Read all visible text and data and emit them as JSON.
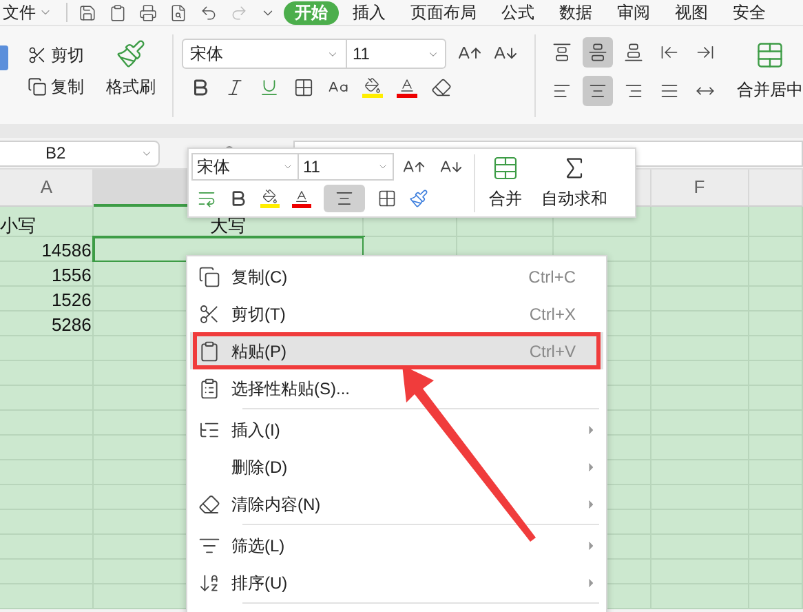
{
  "menu_bar": {
    "file": "文件",
    "tabs": [
      {
        "label": "开始",
        "selected": true
      },
      {
        "label": "插入",
        "selected": false
      },
      {
        "label": "页面布局",
        "selected": false
      },
      {
        "label": "公式",
        "selected": false
      },
      {
        "label": "数据",
        "selected": false
      },
      {
        "label": "审阅",
        "selected": false
      },
      {
        "label": "视图",
        "selected": false
      },
      {
        "label": "安全",
        "selected": false
      }
    ]
  },
  "ribbon": {
    "cut": "剪切",
    "copy": "复制",
    "format_painter": "格式刷",
    "font": "宋体",
    "size": "11",
    "align_top": [
      {
        "selected": false
      },
      {
        "selected": true
      },
      {
        "selected": false
      },
      {
        "selected": false
      },
      {
        "selected": false
      }
    ],
    "align_bottom": [
      {
        "selected": false
      },
      {
        "selected": true
      },
      {
        "selected": false
      },
      {
        "selected": false
      },
      {
        "selected": false
      }
    ],
    "merge": "合并居中"
  },
  "formula_bar": {
    "name_box": "B2"
  },
  "sheet": {
    "columns": [
      {
        "label": "A"
      },
      {
        "selected": true
      },
      {},
      {},
      {},
      {
        "label": "F"
      },
      {}
    ],
    "rows": [
      {
        "a": "小写",
        "b": "大写",
        "selected": false
      },
      {
        "a": "14586",
        "selected": true
      },
      {
        "a": "1556",
        "selected": false
      },
      {
        "a": "1526",
        "selected": false
      },
      {
        "a": "5286",
        "selected": false
      }
    ]
  },
  "mini_toolbar": {
    "font": "宋体",
    "size": "11",
    "merge": "合并",
    "autosum": "自动求和"
  },
  "context_menu": {
    "items": [
      {
        "kind": "item",
        "label": "复制(C)",
        "shortcut": "Ctrl+C",
        "selected": false,
        "submenu": false
      },
      {
        "kind": "item",
        "label": "剪切(T)",
        "shortcut": "Ctrl+X",
        "selected": false,
        "submenu": false
      },
      {
        "kind": "item",
        "label": "粘贴(P)",
        "shortcut": "Ctrl+V",
        "selected": true,
        "submenu": false,
        "annotated": true
      },
      {
        "kind": "item",
        "label": "选择性粘贴(S)...",
        "selected": false,
        "submenu": false
      },
      {
        "kind": "separator"
      },
      {
        "kind": "item",
        "label": "插入(I)",
        "selected": false,
        "submenu": true
      },
      {
        "kind": "item",
        "label": "删除(D)",
        "selected": false,
        "submenu": true
      },
      {
        "kind": "item",
        "label": "清除内容(N)",
        "selected": false,
        "submenu": true
      },
      {
        "kind": "separator"
      },
      {
        "kind": "item",
        "label": "筛选(L)",
        "selected": false,
        "submenu": true
      },
      {
        "kind": "item",
        "label": "排序(U)",
        "selected": false,
        "submenu": true
      },
      {
        "kind": "separator"
      }
    ]
  }
}
